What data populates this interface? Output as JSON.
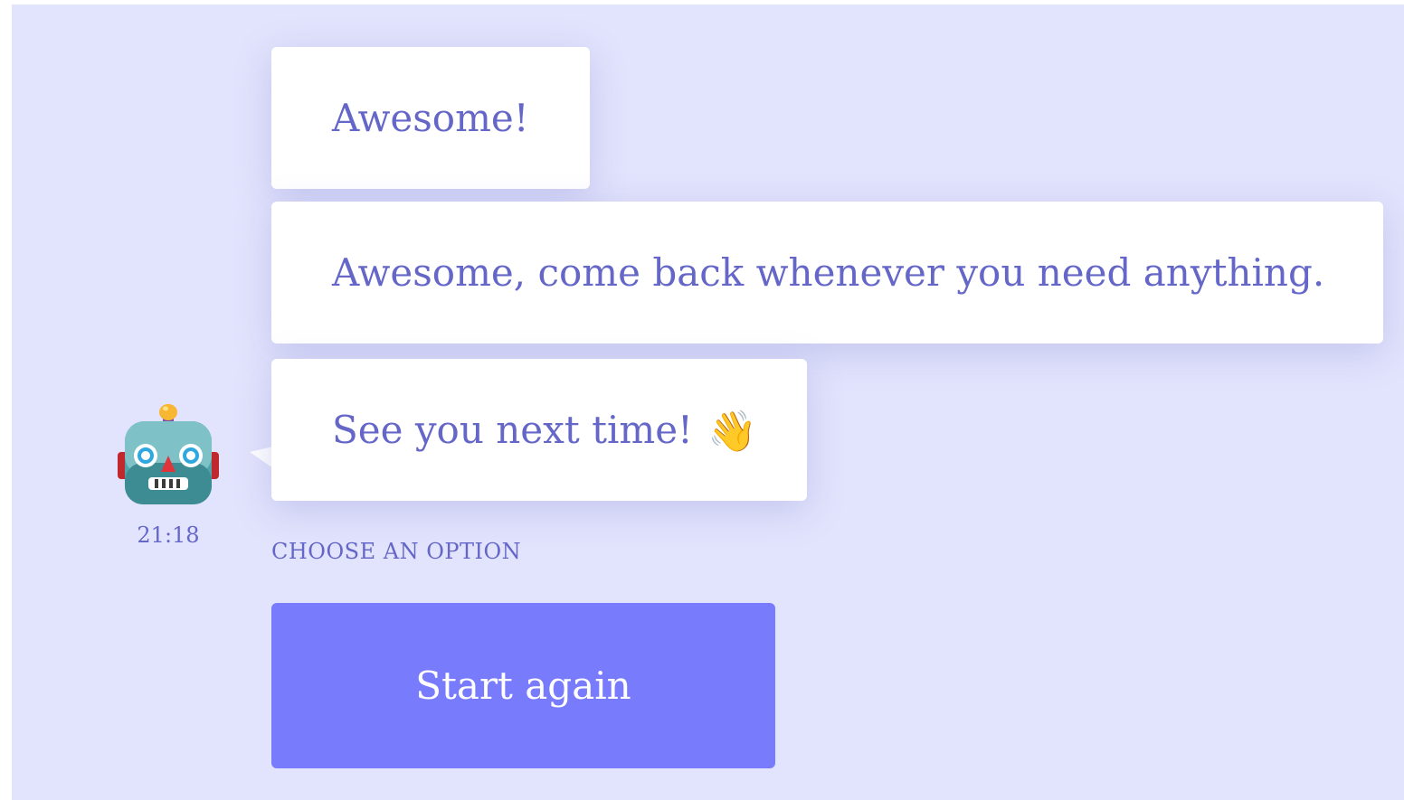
{
  "chat": {
    "messages": [
      {
        "text": "Awesome!"
      },
      {
        "text": "Awesome, come back whenever you need anything."
      },
      {
        "text": "See you next time!",
        "emoji": "👋"
      }
    ],
    "bot": {
      "avatar_icon": "robot-face-icon",
      "timestamp": "21:18"
    },
    "options": {
      "label": "CHOOSE AN OPTION",
      "buttons": [
        {
          "label": "Start again"
        }
      ]
    }
  },
  "colors": {
    "background": "#e2e3fc",
    "bubble": "#ffffff",
    "text": "#6567c8",
    "button": "#797bfd",
    "button_text": "#ffffff"
  }
}
